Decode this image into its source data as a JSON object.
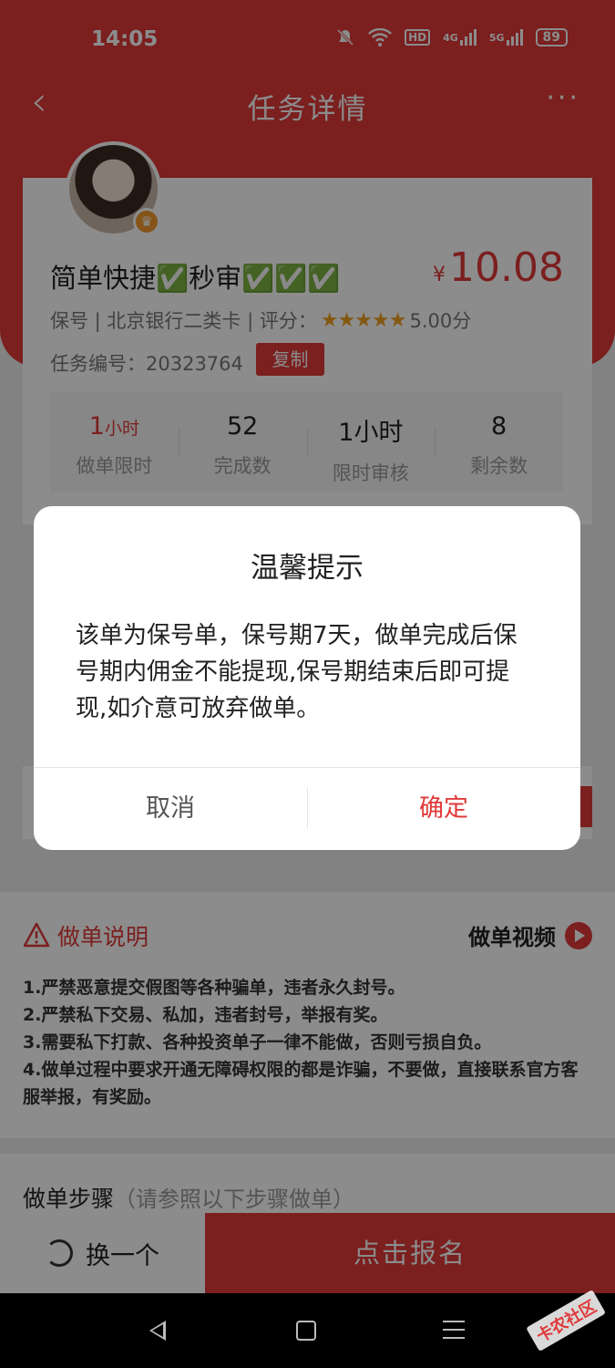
{
  "status_bar": {
    "time": "14:05",
    "hd_label": "HD",
    "net1": "4G",
    "net2": "5G",
    "battery": "89",
    "icons": [
      "mute-bell-icon",
      "wifi-icon",
      "hd-icon",
      "signal-4g-icon",
      "signal-5g-icon",
      "battery-icon"
    ]
  },
  "nav": {
    "title": "任务详情",
    "back_icon": "‹",
    "more_icon": "···"
  },
  "task": {
    "title": "简单快捷✅秒审✅✅✅",
    "price_symbol": "¥",
    "price": "10.08",
    "meta_prefix": "保号 | 北京银行二类卡 | 评分：",
    "stars": "★★★★★",
    "rating": "5.00分",
    "task_no_label": "任务编号：20323764",
    "copy_label": "复制"
  },
  "stats": [
    {
      "value": "1",
      "unit": "小时",
      "label": "做单限时"
    },
    {
      "value": "52",
      "unit": "",
      "label": "完成数"
    },
    {
      "value": "1小时",
      "unit": "",
      "label": "限时审核"
    },
    {
      "value": "8",
      "unit": "",
      "label": "剩余数"
    }
  ],
  "instructions": {
    "heading": "做单说明",
    "video_label": "做单视频",
    "rules": [
      "1.严禁恶意提交假图等各种骗单，违者永久封号。",
      "2.严禁私下交易、私加，违者封号，举报有奖。",
      "3.需要私下打款、各种投资单子一律不能做，否则亏损自负。",
      "4.做单过程中要求开通无障碍权限的都是诈骗，不要做，直接联系官方客服举报，有奖励。"
    ]
  },
  "steps": {
    "title": "做单步骤",
    "hint": "（请参照以下步骤做单）"
  },
  "bottom": {
    "swap_label": "换一个",
    "signup_label": "点击报名"
  },
  "dialog": {
    "title": "温馨提示",
    "body": "该单为保号单，保号期7天，做单完成后保号期内佣金不能提现,保号期结束后即可提现,如介意可放弃做单。",
    "cancel": "取消",
    "confirm": "确定"
  },
  "watermark": "卡农社区",
  "colors": {
    "accent": "#e03a3a",
    "star": "#f0a020"
  }
}
